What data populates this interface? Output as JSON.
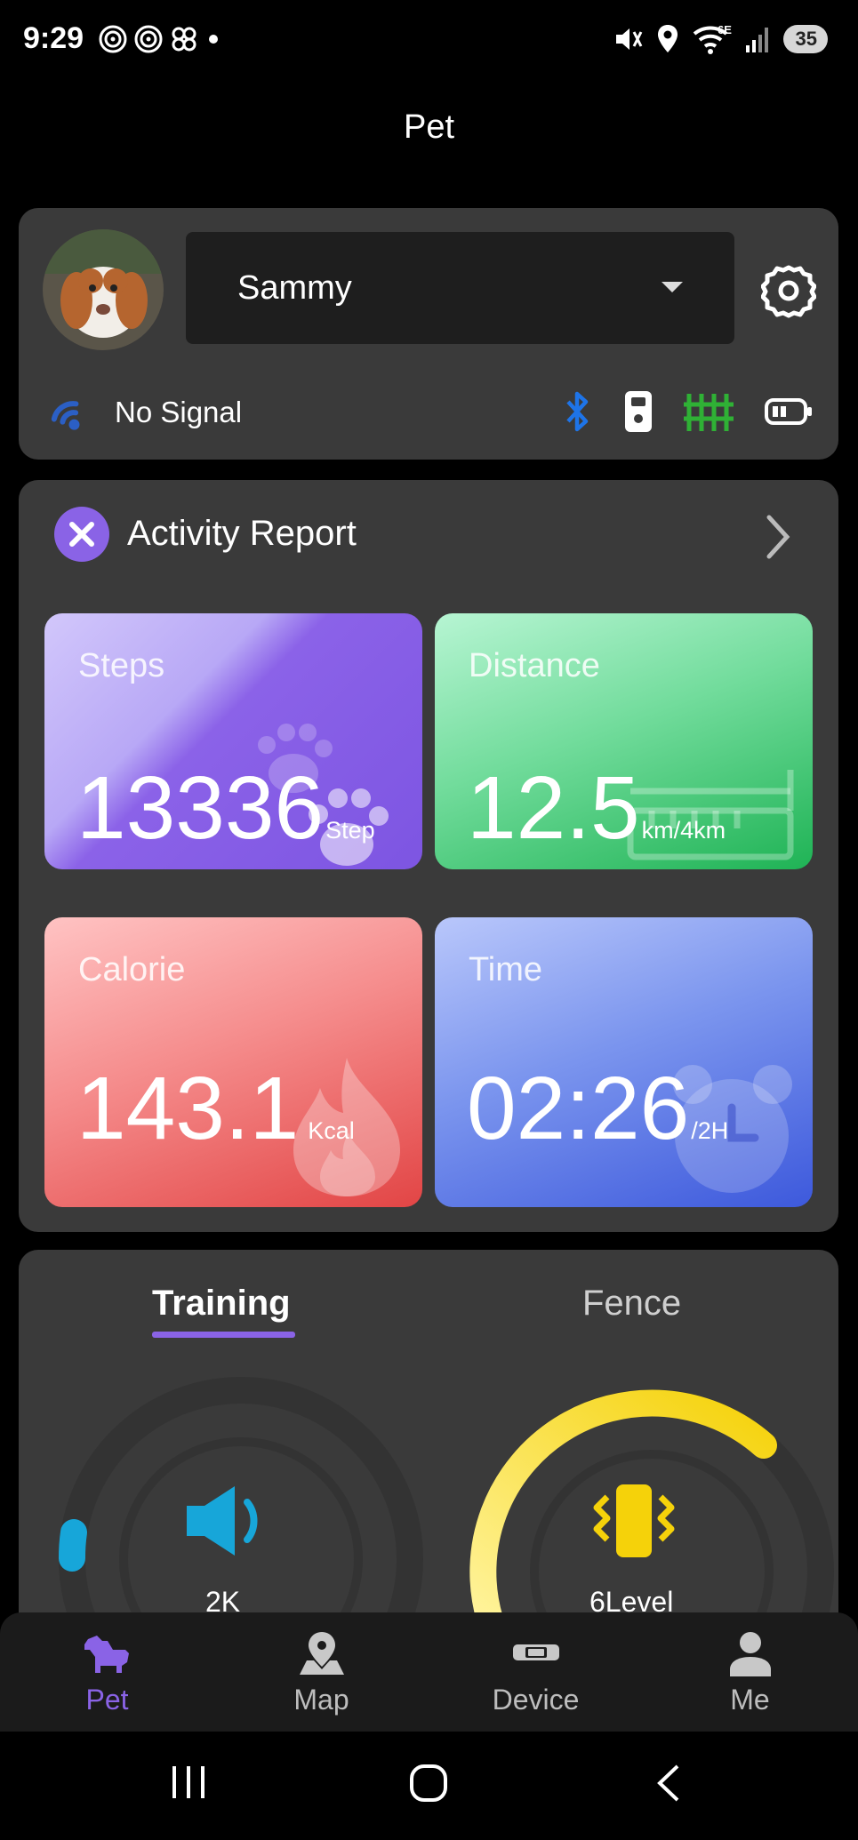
{
  "status_bar": {
    "time": "9:29",
    "network": "6E",
    "battery": "35"
  },
  "app": {
    "title": "Pet"
  },
  "pet": {
    "name": "Sammy",
    "signal_text": "No Signal"
  },
  "activity": {
    "title": "Activity Report",
    "tiles": {
      "steps": {
        "label": "Steps",
        "value": "13336",
        "unit": "Step"
      },
      "distance": {
        "label": "Distance",
        "value": "12.5",
        "unit": "km/4km"
      },
      "calorie": {
        "label": "Calorie",
        "value": "143.1",
        "unit": "Kcal"
      },
      "time": {
        "label": "Time",
        "value": "02:26",
        "unit": "/2H"
      }
    }
  },
  "training": {
    "tabs": [
      "Training",
      "Fence"
    ],
    "sound_value": "2K",
    "vibration_value": "6Level",
    "sound_level": 0.08,
    "vibration_level": 0.6
  },
  "nav": {
    "items": [
      {
        "label": "Pet",
        "icon": "dog-icon"
      },
      {
        "label": "Map",
        "icon": "map-pin-icon"
      },
      {
        "label": "Device",
        "icon": "device-icon"
      },
      {
        "label": "Me",
        "icon": "person-icon"
      }
    ]
  },
  "colors": {
    "accent": "#8a63e6",
    "bluetooth": "#1e74e8",
    "fence_green": "#2fb135",
    "sound_blue": "#17a6d9",
    "vibe_yellow": "#f5d20a"
  }
}
